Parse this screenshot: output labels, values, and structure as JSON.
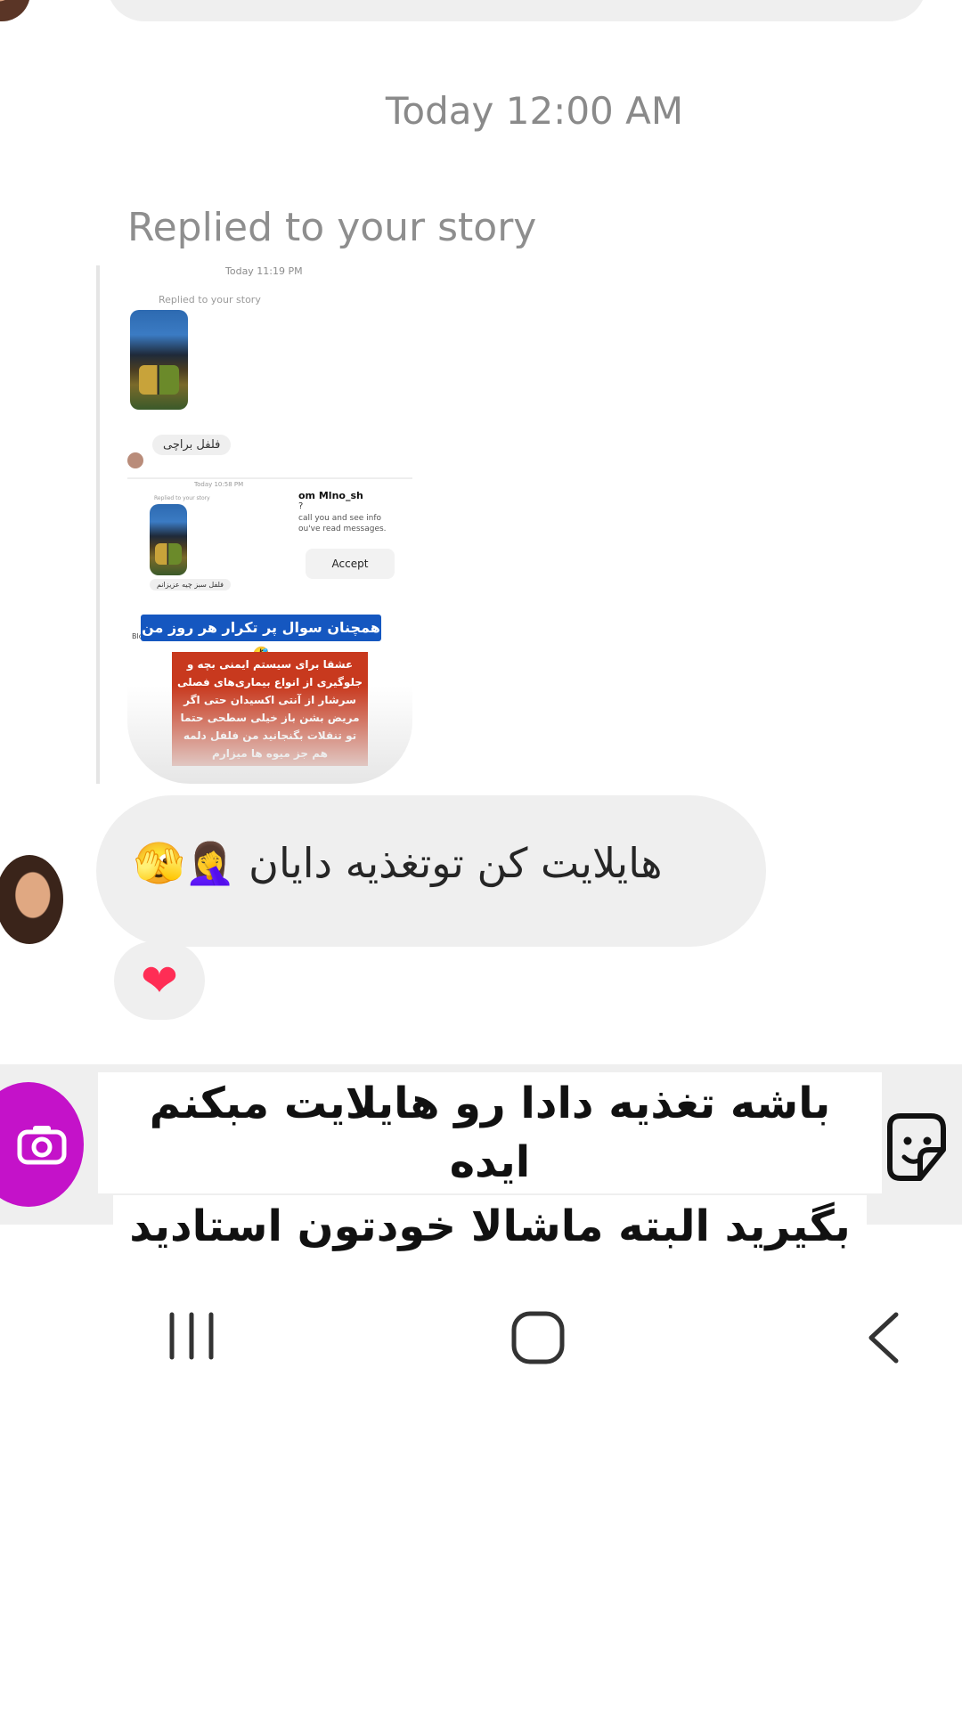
{
  "chat": {
    "timestamp": "Today 12:00 AM",
    "replied_label": "Replied to your story",
    "story_card": {
      "time1": "Today 11:19 PM",
      "replied1": "Replied to your story",
      "reply1": "فلفل براچی",
      "time2": "Today 10:58 PM",
      "replied2": "Replied to your story",
      "reply2": "فلفل سبز چیه عزیزانم",
      "panel_name": "om Mlno_sh",
      "panel_q": "?",
      "panel_info": "call you and see info ou've read messages.",
      "accept_label": "Accept",
      "block_label": "Block",
      "blue_caption": "همچنان سوال پر تکرار هر روز من 🤣",
      "red_caption": "عشقا برای سیستم ایمنی بچه و جلوگیری از انواع بیماری‌های فصلی سرشار از آنتی اکسیدان حتی اگر مریض بشن باز خیلی سطحی حتما تو تنقلات بگنجانید من فلفل دلمه هم جز میوه ها میزارم"
    },
    "message_text": "هایلایت کن توتغذیه دایان 🤦‍♀️🫣",
    "reaction": "❤"
  },
  "caption": {
    "line1": "باشه تغذیه دادا رو هایلایت مبکنم ایده",
    "line2": "بگیرید البته ماشالا خودتون استادید"
  },
  "icons": {
    "camera": "camera-icon",
    "sticker": "sticker-icon",
    "recents": "recents-icon",
    "home": "home-icon",
    "back": "back-icon"
  },
  "colors": {
    "camera_button": "#c412c9",
    "bubble": "#efefef",
    "heart": "#ff2d55"
  }
}
